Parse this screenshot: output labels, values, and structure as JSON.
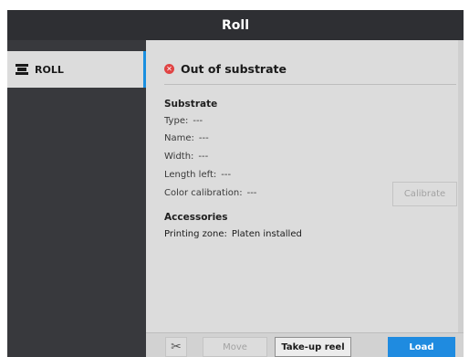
{
  "header": {
    "title": "Roll"
  },
  "sidebar": {
    "items": [
      {
        "label": "ROLL",
        "icon": "roll-icon",
        "selected": true
      }
    ]
  },
  "main": {
    "status": {
      "icon": "error-icon",
      "text": "Out of substrate"
    },
    "substrate": {
      "title": "Substrate",
      "fields": [
        {
          "label": "Type:",
          "value": "---"
        },
        {
          "label": "Name:",
          "value": "---"
        },
        {
          "label": "Width:",
          "value": "---"
        },
        {
          "label": "Length left:",
          "value": "---"
        },
        {
          "label": "Color calibration:",
          "value": "---"
        }
      ],
      "calibrate_label": "Calibrate"
    },
    "accessories": {
      "title": "Accessories",
      "printing_zone_label": "Printing zone:",
      "printing_zone_value": "Platen installed"
    }
  },
  "toolbar": {
    "cut_icon": "scissors-icon",
    "move_label": "Move",
    "takeup_label": "Take-up reel",
    "load_label": "Load"
  },
  "colors": {
    "accent": "#1f8be0",
    "error": "#e04343",
    "header_bg": "#2e2f33",
    "panel_bg": "#dcdcdc"
  }
}
